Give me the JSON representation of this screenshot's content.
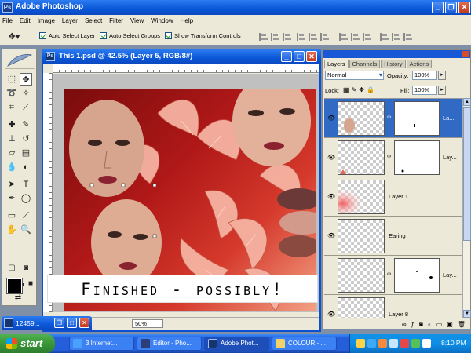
{
  "app": {
    "title": "Adobe Photoshop"
  },
  "menu": [
    "File",
    "Edit",
    "Image",
    "Layer",
    "Select",
    "Filter",
    "View",
    "Window",
    "Help"
  ],
  "options": {
    "auto_select_layer": "Auto Select Layer",
    "auto_select_groups": "Auto Select Groups",
    "show_transform_controls": "Show Transform Controls"
  },
  "document": {
    "title": "This 1.psd @ 42.5% (Layer 5, RGB/8#)",
    "zoom": "50%"
  },
  "caption": "Finished - possibly!",
  "layers_panel": {
    "tabs": [
      "Layers",
      "Channels",
      "History",
      "Actions"
    ],
    "active_tab": "Layers",
    "blend_mode": "Normal",
    "opacity_label": "Opacity:",
    "opacity": "100%",
    "lock_label": "Lock:",
    "fill_label": "Fill:",
    "fill": "100%",
    "layers": [
      {
        "name": "La...",
        "selected": true,
        "visible": true,
        "has_mask": true
      },
      {
        "name": "Lay...",
        "selected": false,
        "visible": true,
        "has_mask": true
      },
      {
        "name": "Layer 1",
        "selected": false,
        "visible": true,
        "has_mask": false
      },
      {
        "name": "Earing",
        "selected": false,
        "visible": true,
        "has_mask": false
      },
      {
        "name": "Lay...",
        "selected": false,
        "visible": false,
        "has_mask": true
      },
      {
        "name": "Layer 8",
        "selected": false,
        "visible": true,
        "has_mask": false
      }
    ]
  },
  "minimized_window": {
    "title": "12459..."
  },
  "taskbar": {
    "start": "start",
    "tasks": [
      {
        "label": "3 Internet...",
        "active": false
      },
      {
        "label": "Editor - Pho...",
        "active": false
      },
      {
        "label": "Adobe Phot...",
        "active": true
      },
      {
        "label": "COLOUR - ...",
        "active": false
      }
    ],
    "clock": "8:10 PM"
  },
  "colors": {
    "xp_blue": "#0a57d8",
    "panel": "#ece9d8",
    "selection": "#316ac5",
    "start_green": "#3a963a"
  }
}
